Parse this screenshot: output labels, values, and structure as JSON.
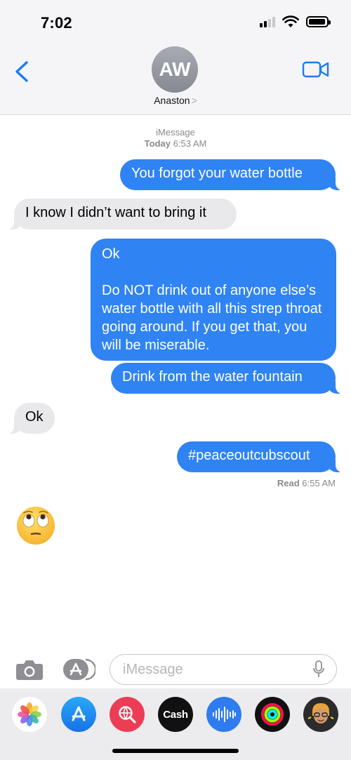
{
  "status_bar": {
    "time": "7:02"
  },
  "header": {
    "avatar_initials": "AW",
    "contact_name": "Anaston",
    "contact_chevron": ">"
  },
  "thread": {
    "service": "iMessage",
    "timestamp_day": "Today",
    "timestamp_time": "6:53 AM",
    "messages": [
      {
        "text": "You forgot your water bottle"
      },
      {
        "text": "I know I didn’t want to bring it"
      },
      {
        "text": "Ok\n\nDo NOT drink out of anyone else’s water bottle with all this strep throat going around. If you get that, you will be miserable."
      },
      {
        "text": "Drink from the water fountain"
      },
      {
        "text": "Ok"
      },
      {
        "text": "#peaceoutcubscout"
      }
    ],
    "read_label": "Read",
    "read_time": "6:55 AM",
    "emoji_name": "face-with-rolling-eyes"
  },
  "composer": {
    "placeholder": "iMessage"
  },
  "drawer": {
    "cash_label": "Cash",
    "cash_symbol": ""
  },
  "colors": {
    "outgoing": "#2f83f3",
    "incoming": "#e9e9eb",
    "accent": "#1a7cf5"
  }
}
